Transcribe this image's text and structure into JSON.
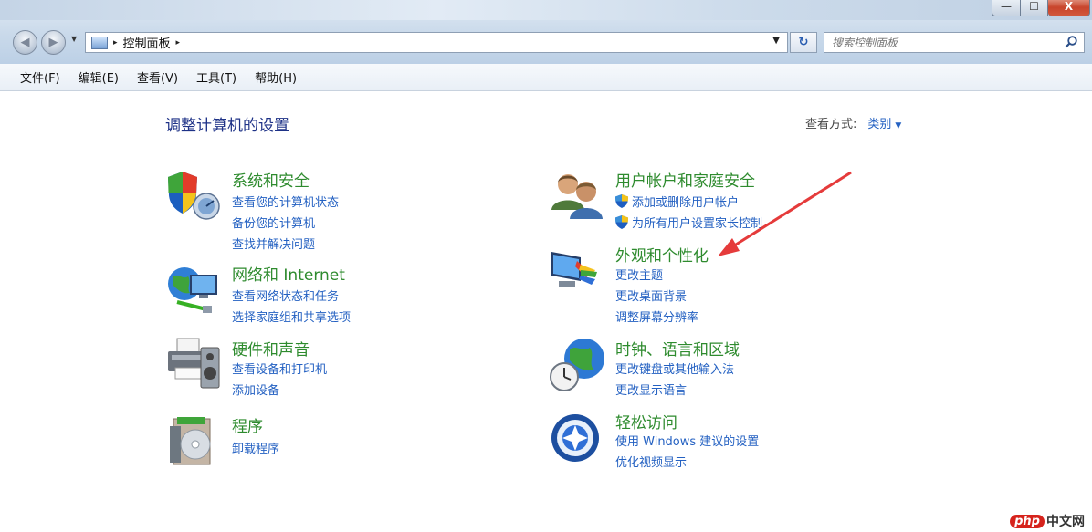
{
  "titlebar": {
    "min_glyph": "—",
    "max_glyph": "☐",
    "close_glyph": "X"
  },
  "address": {
    "crumb": "控制面板",
    "sep": "▸"
  },
  "search": {
    "placeholder": "搜索控制面板"
  },
  "menu": [
    "文件(F)",
    "编辑(E)",
    "查看(V)",
    "工具(T)",
    "帮助(H)"
  ],
  "main": {
    "heading": "调整计算机的设置",
    "view_by_label": "查看方式:",
    "view_by_value": "类别"
  },
  "categories": [
    {
      "title": "系统和安全",
      "icon": "security-shield-icon",
      "links": [
        "查看您的计算机状态",
        "备份您的计算机",
        "查找并解决问题"
      ]
    },
    {
      "title": "网络和 Internet",
      "icon": "network-globe-icon",
      "links": [
        "查看网络状态和任务",
        "选择家庭组和共享选项"
      ]
    },
    {
      "title": "硬件和声音",
      "icon": "printer-speaker-icon",
      "links": [
        "查看设备和打印机",
        "添加设备"
      ]
    },
    {
      "title": "程序",
      "icon": "programs-disc-icon",
      "links": [
        "卸载程序"
      ]
    },
    {
      "title": "用户帐户和家庭安全",
      "icon": "users-icon",
      "links": [
        "添加或删除用户帐户",
        "为所有用户设置家长控制"
      ]
    },
    {
      "title": "外观和个性化",
      "icon": "appearance-monitor-icon",
      "links": [
        "更改主题",
        "更改桌面背景",
        "调整屏幕分辨率"
      ]
    },
    {
      "title": "时钟、语言和区域",
      "icon": "clock-globe-icon",
      "links": [
        "更改键盘或其他输入法",
        "更改显示语言"
      ]
    },
    {
      "title": "轻松访问",
      "icon": "ease-of-access-icon",
      "links": [
        "使用 Windows 建议的设置",
        "优化视频显示"
      ]
    }
  ],
  "watermark": {
    "badge": "php",
    "text": "中文网"
  },
  "colors": {
    "category_title": "#2e8b2e",
    "link": "#2461c2",
    "heading": "#1e3287",
    "arrow": "#e53b3b"
  }
}
